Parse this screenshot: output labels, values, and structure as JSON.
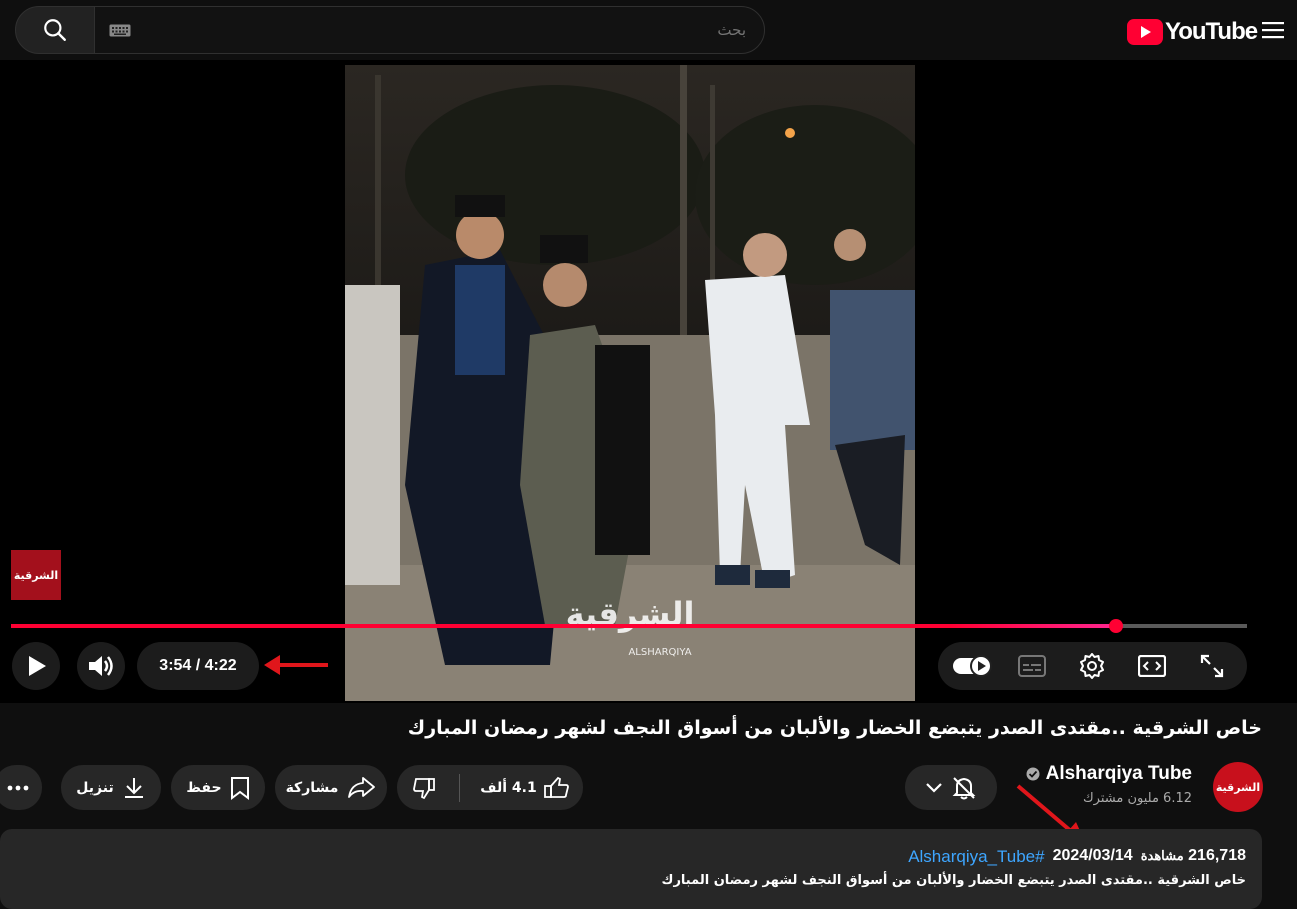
{
  "search": {
    "placeholder": "بحث"
  },
  "brand": {
    "logo_text": "YouTube"
  },
  "player": {
    "watermark_text": "الشرقية",
    "current_time": "3:54",
    "duration": "4:22",
    "time_display": "3:54 / 4:22",
    "progress_fraction": 0.894,
    "video_overlay_text": "الشرقية",
    "video_overlay_sub": "ALSHARQIYA"
  },
  "video": {
    "title": "خاص الشرقية ..مقتدى الصدر يتبضع الخضار والألبان من أسواق النجف لشهر رمضان المبارك"
  },
  "channel": {
    "name": "Alsharqiya Tube",
    "subscribers": "6.12 مليون مشترك",
    "avatar_text": "الشرقية"
  },
  "actions": {
    "like_count": "4.1 ألف",
    "share_label": "مشاركة",
    "save_label": "حفظ",
    "download_label": "تنزيل"
  },
  "description": {
    "views": "216,718",
    "views_label": "مشاهدة",
    "date": "2024/03/14",
    "hashtag": "#Alsharqiya_Tube",
    "text": "خاص الشرقية ..مقتدى الصدر يتبضع الخضار والألبان من أسواق النجف لشهر رمضان المبارك"
  },
  "colors": {
    "accent_red": "#ff0033",
    "annotation_arrow": "#e0161b",
    "link_blue": "#3ea6ff"
  }
}
